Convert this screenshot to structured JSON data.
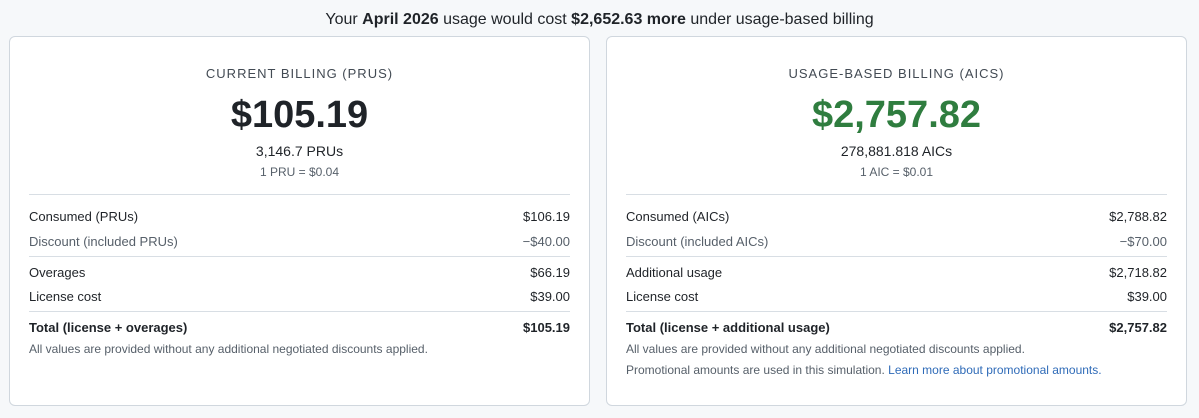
{
  "headline": {
    "prefix": "Your ",
    "month": "April 2026",
    "middle": " usage would cost ",
    "amount": "$2,652.63 more",
    "suffix": " under usage-based billing"
  },
  "current": {
    "title": "CURRENT BILLING (PRUS)",
    "amount": "$105.19",
    "units": "3,146.7 PRUs",
    "rate": "1 PRU = $0.04",
    "rows": [
      {
        "label": "Consumed (PRUs)",
        "value": "$106.19"
      },
      {
        "label": "Discount (included PRUs)",
        "value": "−$40.00"
      },
      {
        "label": "Overages",
        "value": "$66.19"
      },
      {
        "label": "License cost",
        "value": "$39.00"
      },
      {
        "label": "Total (license + overages)",
        "value": "$105.19"
      }
    ],
    "note": "All values are provided without any additional negotiated discounts applied."
  },
  "usage": {
    "title": "USAGE-BASED BILLING (AICS)",
    "amount": "$2,757.82",
    "amount_color": "#2f7d3f",
    "units": "278,881.818 AICs",
    "rate": "1 AIC = $0.01",
    "rows": [
      {
        "label": "Consumed (AICs)",
        "value": "$2,788.82"
      },
      {
        "label": "Discount (included AICs)",
        "value": "−$70.00"
      },
      {
        "label": "Additional usage",
        "value": "$2,718.82"
      },
      {
        "label": "License cost",
        "value": "$39.00"
      },
      {
        "label": "Total (license + additional usage)",
        "value": "$2,757.82"
      }
    ],
    "note": "All values are provided without any additional negotiated discounts applied.",
    "promo_text": "Promotional amounts are used in this simulation. ",
    "promo_link": "Learn more about promotional amounts."
  }
}
